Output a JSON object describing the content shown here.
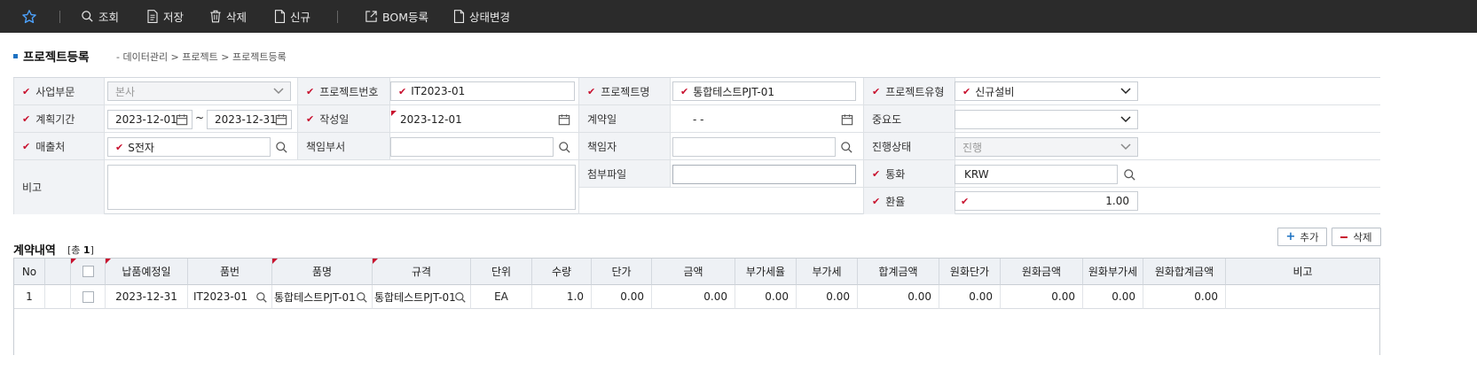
{
  "toolbar": {
    "items": [
      {
        "label": "조회",
        "icon": "search-icon"
      },
      {
        "label": "저장",
        "icon": "document-icon"
      },
      {
        "label": "삭제",
        "icon": "trash-icon"
      },
      {
        "label": "신규",
        "icon": "new-file-icon"
      },
      {
        "label": "BOM등록",
        "icon": "external-link-icon"
      },
      {
        "label": "상태변경",
        "icon": "document-icon"
      }
    ]
  },
  "page": {
    "title": "프로젝트등록",
    "breadcrumb": "- 데이터관리 > 프로젝트 > 프로젝트등록"
  },
  "form": {
    "business_unit": {
      "label": "사업부문",
      "value": "본사"
    },
    "project_no": {
      "label": "프로젝트번호",
      "value": "IT2023-01"
    },
    "project_name": {
      "label": "프로젝트명",
      "value": "통합테스트PJT-01"
    },
    "project_type": {
      "label": "프로젝트유형",
      "value": "신규설비"
    },
    "plan_period": {
      "label": "계획기간",
      "from": "2023-12-01",
      "sep": "~",
      "to": "2023-12-31"
    },
    "created_date": {
      "label": "작성일",
      "value": "2023-12-01"
    },
    "contract_date": {
      "label": "계약일",
      "value": "-  -"
    },
    "importance": {
      "label": "중요도",
      "value": ""
    },
    "customer": {
      "label": "매출처",
      "value": "S전자"
    },
    "resp_dept": {
      "label": "책임부서",
      "value": ""
    },
    "resp_person": {
      "label": "책임자",
      "value": ""
    },
    "progress_status": {
      "label": "진행상태",
      "value": "진행"
    },
    "remark": {
      "label": "비고",
      "value": ""
    },
    "attachment": {
      "label": "첨부파일",
      "value": ""
    },
    "currency": {
      "label": "통화",
      "value": "KRW"
    },
    "exchange_rate": {
      "label": "환율",
      "value": "1.00"
    }
  },
  "contract": {
    "title": "계약내역",
    "count_prefix": "[총",
    "count": "1",
    "count_suffix": "]",
    "add_label": "추가",
    "delete_label": "삭제",
    "columns": [
      "No",
      "",
      "",
      "납품예정일",
      "품번",
      "품명",
      "규격",
      "단위",
      "수량",
      "단가",
      "금액",
      "부가세율",
      "부가세",
      "합계금액",
      "원화단가",
      "원화금액",
      "원화부가세",
      "원화합계금액",
      "비고"
    ],
    "rows": [
      [
        "1",
        "",
        "",
        "2023-12-31",
        "IT2023-01",
        "통합테스트PJT-01",
        "통합테스트PJT-01",
        "EA",
        "1.0",
        "0.00",
        "0.00",
        "0.00",
        "0.00",
        "0.00",
        "0.00",
        "0.00",
        "0.00",
        "0.00",
        ""
      ]
    ]
  },
  "colors": {
    "accent": "#1d72c2",
    "required": "#c8102e",
    "toolbar_bg": "#2b2b2b"
  }
}
